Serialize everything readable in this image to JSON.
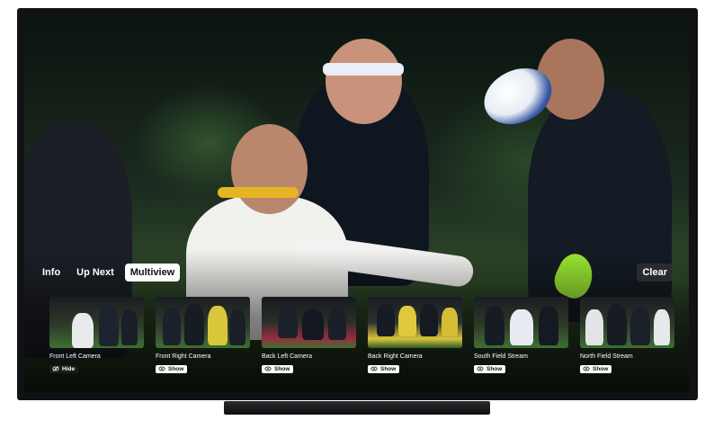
{
  "tabs": [
    {
      "label": "Info",
      "active": false
    },
    {
      "label": "Up Next",
      "active": false
    },
    {
      "label": "Multiview",
      "active": true
    }
  ],
  "clear_label": "Clear",
  "cameras": [
    {
      "label": "Front Left Camera",
      "action": "Hide",
      "icon": "eye-slash-icon"
    },
    {
      "label": "Front Right Camera",
      "action": "Show",
      "icon": "eye-icon"
    },
    {
      "label": "Back Left Camera",
      "action": "Show",
      "icon": "eye-icon"
    },
    {
      "label": "Back Right Camera",
      "action": "Show",
      "icon": "eye-icon"
    },
    {
      "label": "South Field Stream",
      "action": "Show",
      "icon": "eye-icon"
    },
    {
      "label": "North Field Stream",
      "action": "Show",
      "icon": "eye-icon"
    }
  ],
  "colors": {
    "accent_active_tab": "#ffffff",
    "pitch_green": "#3f6f33"
  }
}
